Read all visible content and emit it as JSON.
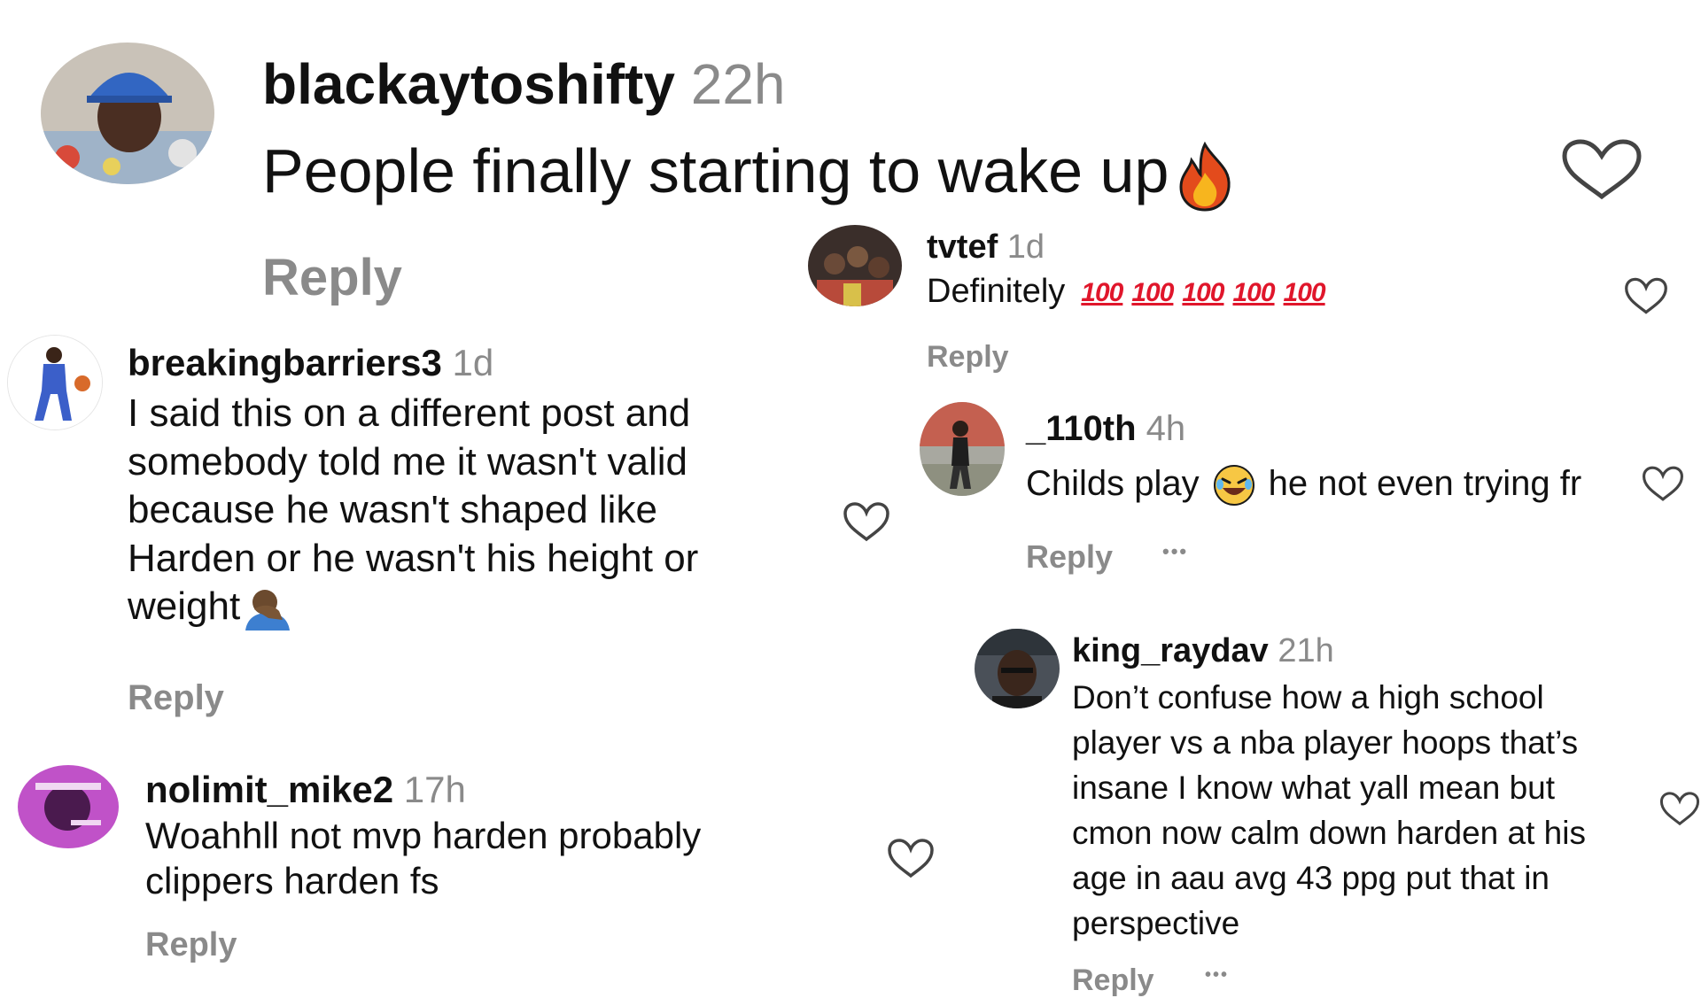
{
  "colors": {
    "text": "#111111",
    "muted": "#8a8a8a",
    "heart_stroke": "#444444",
    "hundred": "#e0162b",
    "fire_orange": "#f7931e",
    "fire_red": "#e34b1c"
  },
  "comments": [
    {
      "username": "blackaytoshifty",
      "time": "22h",
      "text": "People finally starting to wake up",
      "emoji": "fire-emoji",
      "reply_label": "Reply"
    },
    {
      "username": "breakingbarriers3",
      "time": "1d",
      "text_lines": [
        "I said this on a different post and",
        "somebody told me it wasn't valid",
        "because he wasn't shaped like",
        "Harden or he wasn't his height or",
        "weight"
      ],
      "emoji": "facepalm-emoji",
      "reply_label": "Reply"
    },
    {
      "username": "nolimit_mike2",
      "time": "17h",
      "text_lines": [
        "Woahhll not mvp harden probably",
        "clippers harden fs"
      ],
      "reply_label": "Reply"
    },
    {
      "username": "tvtef",
      "time": "1d",
      "text": "Definitely",
      "hundreds": [
        "100",
        "100",
        "100",
        "100",
        "100"
      ],
      "reply_label": "Reply"
    },
    {
      "username": "_110th",
      "time": "4h",
      "text_before": "Childs play",
      "text_after": "he not even trying fr",
      "emoji": "laughing-emoji",
      "reply_label": "Reply",
      "more_label": "•••"
    },
    {
      "username": "king_raydav",
      "time": "21h",
      "text_lines": [
        "Don’t confuse how a high school",
        "player vs a nba player hoops that’s",
        "insane I know what yall mean but",
        "cmon now calm down harden at his",
        "age in aau avg 43 ppg put that in",
        "perspective"
      ],
      "reply_label": "Reply",
      "more_label": "•••"
    }
  ]
}
